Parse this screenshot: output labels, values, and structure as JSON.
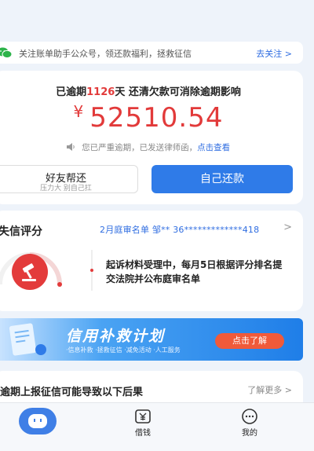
{
  "notice": {
    "text": "关注账单助手公众号，领还款福利，拯救征信",
    "link": "去关注 >",
    "icon": "wechat-icon"
  },
  "overdue": {
    "prefix": "已逾期",
    "days": "1126",
    "suffix": "天 还清欠款可消除逾期影响",
    "currency": "¥",
    "amount": "52510.54",
    "warning": "您已严重逾期，已发送律师函，",
    "warning_link": "点击查看"
  },
  "buttons": {
    "friend_title": "好友帮还",
    "friend_sub": "压力大 别自己扛",
    "self": "自己还款"
  },
  "credit": {
    "title": "失信评分",
    "list_text": "2月庭审名单 邹** 36*************418",
    "arrow": ">",
    "description": "起诉材料受理中，每月5日根据评分排名提交法院并公布庭审名单"
  },
  "banner": {
    "title": "信用补救计划",
    "subtitle": "·信息补救 ·拯救征信 ·减免活动 ·人工服务",
    "button": "点击了解"
  },
  "consequence": {
    "title": "逾期上报征信可能导致以下后果",
    "more": "了解更多 >"
  },
  "tabbar": {
    "home_label": "",
    "borrow_label": "借钱",
    "mine_label": "我的"
  },
  "colors": {
    "accent": "#2f7be8",
    "danger": "#e23a3a",
    "link": "#2f6de1"
  }
}
